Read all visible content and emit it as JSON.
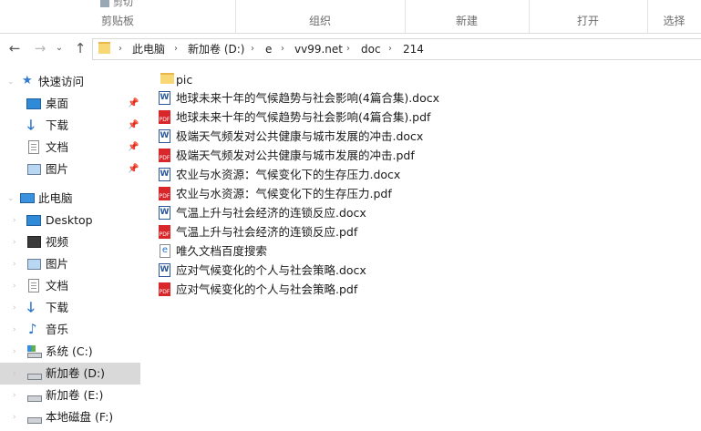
{
  "ribbon": {
    "groups": [
      "剪贴板",
      "组织",
      "新建",
      "打开",
      "选择"
    ],
    "cut_texts": [
      "剪切"
    ]
  },
  "address": {
    "crumbs": [
      "此电脑",
      "新加卷 (D:)",
      "e",
      "vv99.net",
      "doc",
      "214"
    ]
  },
  "sidebar": {
    "quick_access": "快速访问",
    "quick_items": [
      {
        "label": "桌面",
        "icon": "desktop-icon"
      },
      {
        "label": "下载",
        "icon": "download-icon"
      },
      {
        "label": "文档",
        "icon": "document-icon"
      },
      {
        "label": "图片",
        "icon": "pictures-icon"
      }
    ],
    "this_pc": "此电脑",
    "pc_items": [
      {
        "label": "Desktop",
        "icon": "desktop-icon"
      },
      {
        "label": "视频",
        "icon": "video-icon"
      },
      {
        "label": "图片",
        "icon": "pictures-icon"
      },
      {
        "label": "文档",
        "icon": "document-icon"
      },
      {
        "label": "下载",
        "icon": "download-icon"
      },
      {
        "label": "音乐",
        "icon": "music-icon"
      },
      {
        "label": "系统 (C:)",
        "icon": "system-drive-icon"
      },
      {
        "label": "新加卷 (D:)",
        "icon": "drive-icon"
      },
      {
        "label": "新加卷 (E:)",
        "icon": "drive-icon"
      },
      {
        "label": "本地磁盘 (F:)",
        "icon": "drive-icon"
      }
    ]
  },
  "files": [
    {
      "name": "pic",
      "type": "folder"
    },
    {
      "name": "地球未来十年的气候趋势与社会影响(4篇合集).docx",
      "type": "docx"
    },
    {
      "name": "地球未来十年的气候趋势与社会影响(4篇合集).pdf",
      "type": "pdf"
    },
    {
      "name": "极端天气频发对公共健康与城市发展的冲击.docx",
      "type": "docx"
    },
    {
      "name": "极端天气频发对公共健康与城市发展的冲击.pdf",
      "type": "pdf"
    },
    {
      "name": "农业与水资源：气候变化下的生存压力.docx",
      "type": "docx"
    },
    {
      "name": "农业与水资源：气候变化下的生存压力.pdf",
      "type": "pdf"
    },
    {
      "name": "气温上升与社会经济的连锁反应.docx",
      "type": "docx"
    },
    {
      "name": "气温上升与社会经济的连锁反应.pdf",
      "type": "pdf"
    },
    {
      "name": "唯久文档百度搜索",
      "type": "link"
    },
    {
      "name": "应对气候变化的个人与社会策略.docx",
      "type": "docx"
    },
    {
      "name": "应对气候变化的个人与社会策略.pdf",
      "type": "pdf"
    }
  ]
}
